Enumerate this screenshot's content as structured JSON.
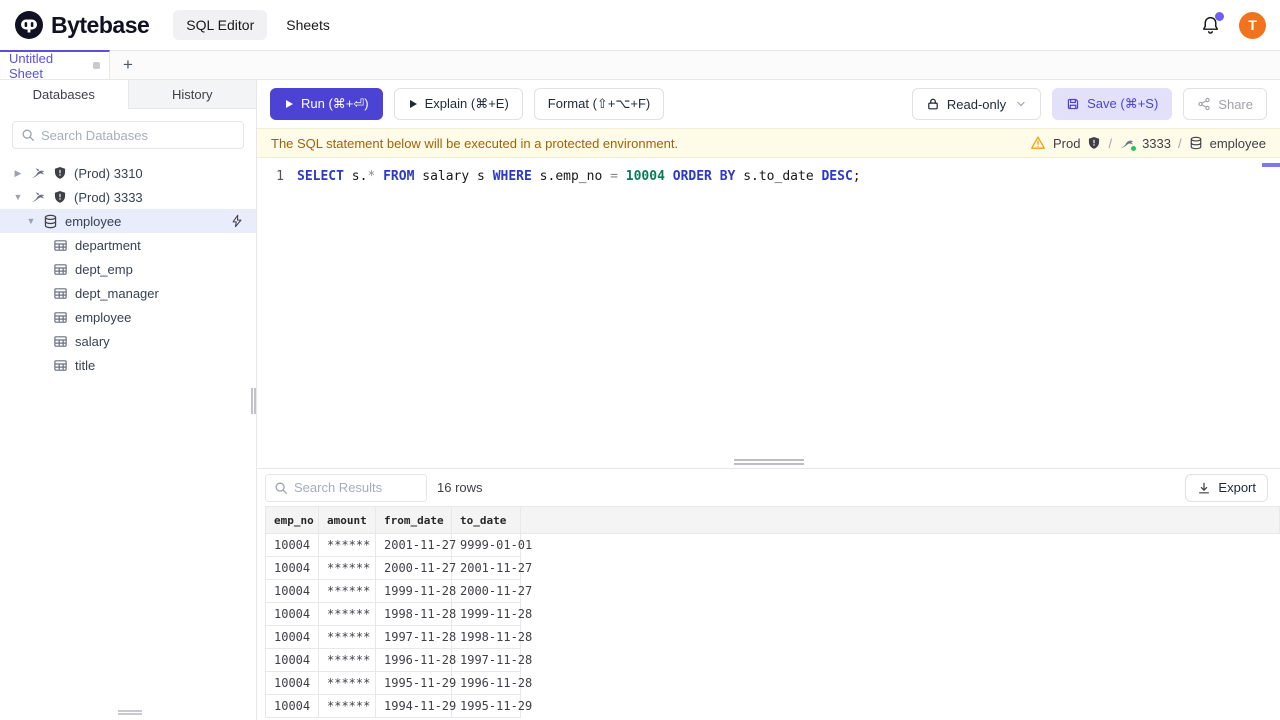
{
  "header": {
    "brand": "Bytebase",
    "nav": [
      {
        "label": "SQL Editor"
      },
      {
        "label": "Sheets"
      }
    ],
    "avatar_initial": "T"
  },
  "tabstrip": {
    "active_tab": "Untitled Sheet",
    "add_button": "+"
  },
  "sidebar": {
    "tabs": [
      {
        "label": "Databases"
      },
      {
        "label": "History"
      }
    ],
    "search_placeholder": "Search Databases",
    "tree": {
      "instances": [
        {
          "label": "(Prod) 3310"
        },
        {
          "label": "(Prod) 3333"
        }
      ],
      "database": "employee",
      "tables": [
        "department",
        "dept_emp",
        "dept_manager",
        "employee",
        "salary",
        "title"
      ]
    }
  },
  "toolbar": {
    "run": "Run (⌘+⏎)",
    "explain": "Explain (⌘+E)",
    "format": "Format (⇧+⌥+F)",
    "readonly": "Read-only",
    "save": "Save (⌘+S)",
    "share": "Share"
  },
  "banner": {
    "message": "The SQL statement below will be executed in a protected environment.",
    "environment": "Prod",
    "separator": "/",
    "instance": "3333",
    "database": "employee"
  },
  "editor": {
    "line_number": "1",
    "sql_text": "SELECT s.* FROM salary s WHERE s.emp_no = 10004 ORDER BY s.to_date DESC;",
    "tokens": [
      [
        "SELECT",
        "kw"
      ],
      [
        " s.",
        "pl"
      ],
      [
        "*",
        "op"
      ],
      [
        " ",
        "pl"
      ],
      [
        "FROM",
        "kw"
      ],
      [
        " salary s ",
        "pl"
      ],
      [
        "WHERE",
        "kw"
      ],
      [
        " s.emp_no ",
        "pl"
      ],
      [
        "=",
        "op"
      ],
      [
        " ",
        "pl"
      ],
      [
        "10004",
        "num"
      ],
      [
        " ",
        "pl"
      ],
      [
        "ORDER BY",
        "kw"
      ],
      [
        " s.to_date ",
        "pl"
      ],
      [
        "DESC",
        "kw"
      ],
      [
        ";",
        "pl"
      ]
    ]
  },
  "results": {
    "search_placeholder": "Search Results",
    "row_count": "16 rows",
    "export_label": "Export",
    "table": {
      "columns": [
        "emp_no",
        "amount",
        "from_date",
        "to_date"
      ],
      "rows": [
        [
          "10004",
          "******",
          "2001-11-27",
          "9999-01-01"
        ],
        [
          "10004",
          "******",
          "2000-11-27",
          "2001-11-27"
        ],
        [
          "10004",
          "******",
          "1999-11-28",
          "2000-11-27"
        ],
        [
          "10004",
          "******",
          "1998-11-28",
          "1999-11-28"
        ],
        [
          "10004",
          "******",
          "1997-11-28",
          "1998-11-28"
        ],
        [
          "10004",
          "******",
          "1996-11-28",
          "1997-11-28"
        ],
        [
          "10004",
          "******",
          "1995-11-29",
          "1996-11-28"
        ],
        [
          "10004",
          "******",
          "1994-11-29",
          "1995-11-29"
        ]
      ]
    }
  },
  "colors": {
    "accent": "#4c43d4",
    "warning_bg": "#fefce8",
    "warning_text": "#a16207",
    "avatar_bg": "#f2731d",
    "status_green": "#22c55e"
  }
}
